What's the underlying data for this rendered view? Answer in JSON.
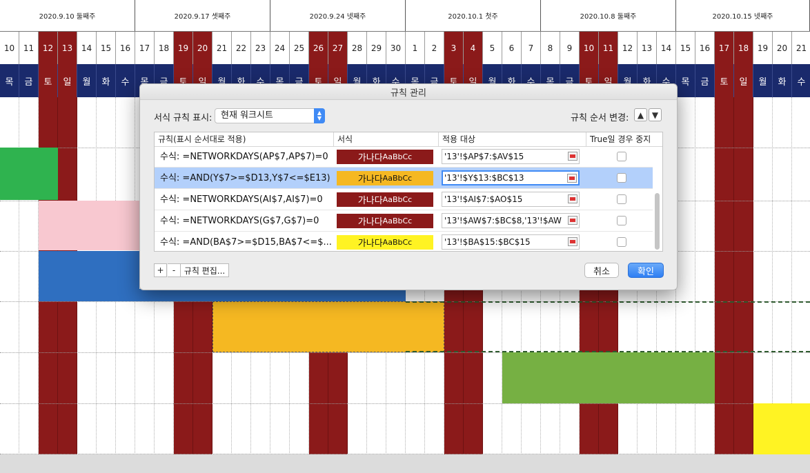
{
  "sheet": {
    "weeks": [
      {
        "label": "2020.9.10 둘째주"
      },
      {
        "label": "2020.9.17 셋째주"
      },
      {
        "label": "2020.9.24 넷째주"
      },
      {
        "label": "2020.10.1 첫주"
      },
      {
        "label": "2020.10.8 둘째주"
      },
      {
        "label": "2020.10.15 넷째주"
      }
    ],
    "days": [
      "10",
      "11",
      "12",
      "13",
      "14",
      "15",
      "16",
      "17",
      "18",
      "19",
      "20",
      "21",
      "22",
      "23",
      "24",
      "25",
      "26",
      "27",
      "28",
      "29",
      "30",
      "1",
      "2",
      "3",
      "4",
      "5",
      "6",
      "7",
      "8",
      "9",
      "10",
      "11",
      "12",
      "13",
      "14",
      "15",
      "16",
      "17",
      "18",
      "19",
      "20",
      "21"
    ],
    "day_names": [
      "목",
      "금",
      "토",
      "일",
      "월",
      "화",
      "수",
      "목",
      "금",
      "토",
      "일",
      "월",
      "화",
      "수",
      "목",
      "금",
      "토",
      "일",
      "월",
      "화",
      "수",
      "목",
      "금",
      "토",
      "일",
      "월",
      "화",
      "수",
      "목",
      "금",
      "토",
      "일",
      "월",
      "화",
      "수",
      "목",
      "금",
      "토",
      "일",
      "월",
      "화",
      "수"
    ],
    "colors": {
      "weekend": "#8B1A1A",
      "header_navy": "#1a2a6c",
      "green": "#2fb34f",
      "pink": "#f8c8d0",
      "blue": "#2f6fc0",
      "orange": "#f5b822",
      "olive": "#76b043",
      "yellow": "#fff323"
    }
  },
  "dialog": {
    "title": "규칙 관리",
    "show_rules_label": "서식 규칙 표시:",
    "show_rules_value": "현재 워크시트",
    "order_label": "규칙 순서 변경:",
    "order_up_icon": "arrow-up-icon",
    "order_down_icon": "arrow-down-icon",
    "columns": [
      "규칙(표시 순서대로 적용)",
      "서식",
      "적용 대상",
      "True일 경우 중지"
    ],
    "rules": [
      {
        "formula": "수식: =NETWORKDAYS(AP$7,AP$7)=0",
        "preview": "가나다",
        "preview_latin": "AaBbCc",
        "fill": "#8B1A1A",
        "text_color": "#ffffff",
        "range": "'13'!$AP$7:$AV$15",
        "selected": false
      },
      {
        "formula": "수식: =AND(Y$7>=$D13,Y$7<=$E13)",
        "preview": "가나다",
        "preview_latin": "AaBbCc",
        "fill": "#f5b822",
        "text_color": "#111111",
        "range": "'13'!$Y$13:$BC$13",
        "selected": true
      },
      {
        "formula": "수식: =NETWORKDAYS(AI$7,AI$7)=0",
        "preview": "가나다",
        "preview_latin": "AaBbCc",
        "fill": "#8B1A1A",
        "text_color": "#ffffff",
        "range": "'13'!$AI$7:$AO$15",
        "selected": false
      },
      {
        "formula": "수식: =NETWORKDAYS(G$7,G$7)=0",
        "preview": "가나다",
        "preview_latin": "AaBbCc",
        "fill": "#8B1A1A",
        "text_color": "#ffffff",
        "range": "'13'!$AW$7:$BC$8,'13'!$AW",
        "selected": false
      },
      {
        "formula": "수식: =AND(BA$7>=$D15,BA$7<=$...",
        "preview": "가나다",
        "preview_latin": "AaBbCc",
        "fill": "#fff323",
        "text_color": "#111111",
        "range": "'13'!$BA$15:$BC$15",
        "selected": false
      }
    ],
    "add_label": "+",
    "remove_label": "-",
    "edit_label": "규칙 편집...",
    "cancel_label": "취소",
    "ok_label": "확인"
  }
}
